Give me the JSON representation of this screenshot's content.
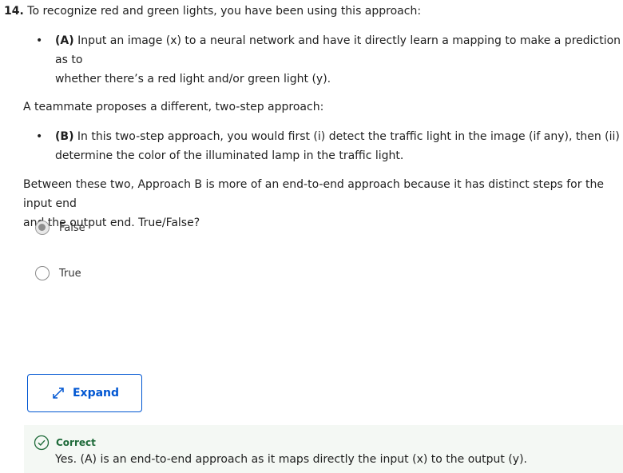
{
  "question": {
    "number": "14.",
    "prompt": "To recognize red and green lights, you have been using this approach:",
    "approach_a_tag": "(A)",
    "approach_a_line1": "Input an image (x) to a neural network and have it directly learn a mapping to make a prediction as to",
    "approach_a_line2": "whether there’s a red light and/or green light (y).",
    "teammate_text": "A teammate proposes a different, two-step approach:",
    "approach_b_tag": "(B)",
    "approach_b_line1": "In this two-step approach, you would first (i) detect the traffic light in the image (if any), then (ii)",
    "approach_b_line2": "determine the color of the illuminated lamp in the traffic light.",
    "statement_line1": "Between these two, Approach B is more of an end-to-end approach because it has distinct steps for the input end",
    "statement_line2": "and the output end. True/False?",
    "bullet_char": "•"
  },
  "options": [
    {
      "label": "False",
      "selected": true
    },
    {
      "label": "True",
      "selected": false
    }
  ],
  "expand_button": {
    "label": "Expand",
    "icon": "expand-arrows-icon"
  },
  "feedback": {
    "status": "Correct",
    "message": "Yes. (A) is an end-to-end approach as it maps directly the input (x) to the output (y).",
    "icon": "check-circle-icon",
    "color": "#1f6b3a"
  },
  "colors": {
    "accent": "#0056d2",
    "correct": "#1f6b3a",
    "feedback_bg": "#f4f8f4"
  }
}
